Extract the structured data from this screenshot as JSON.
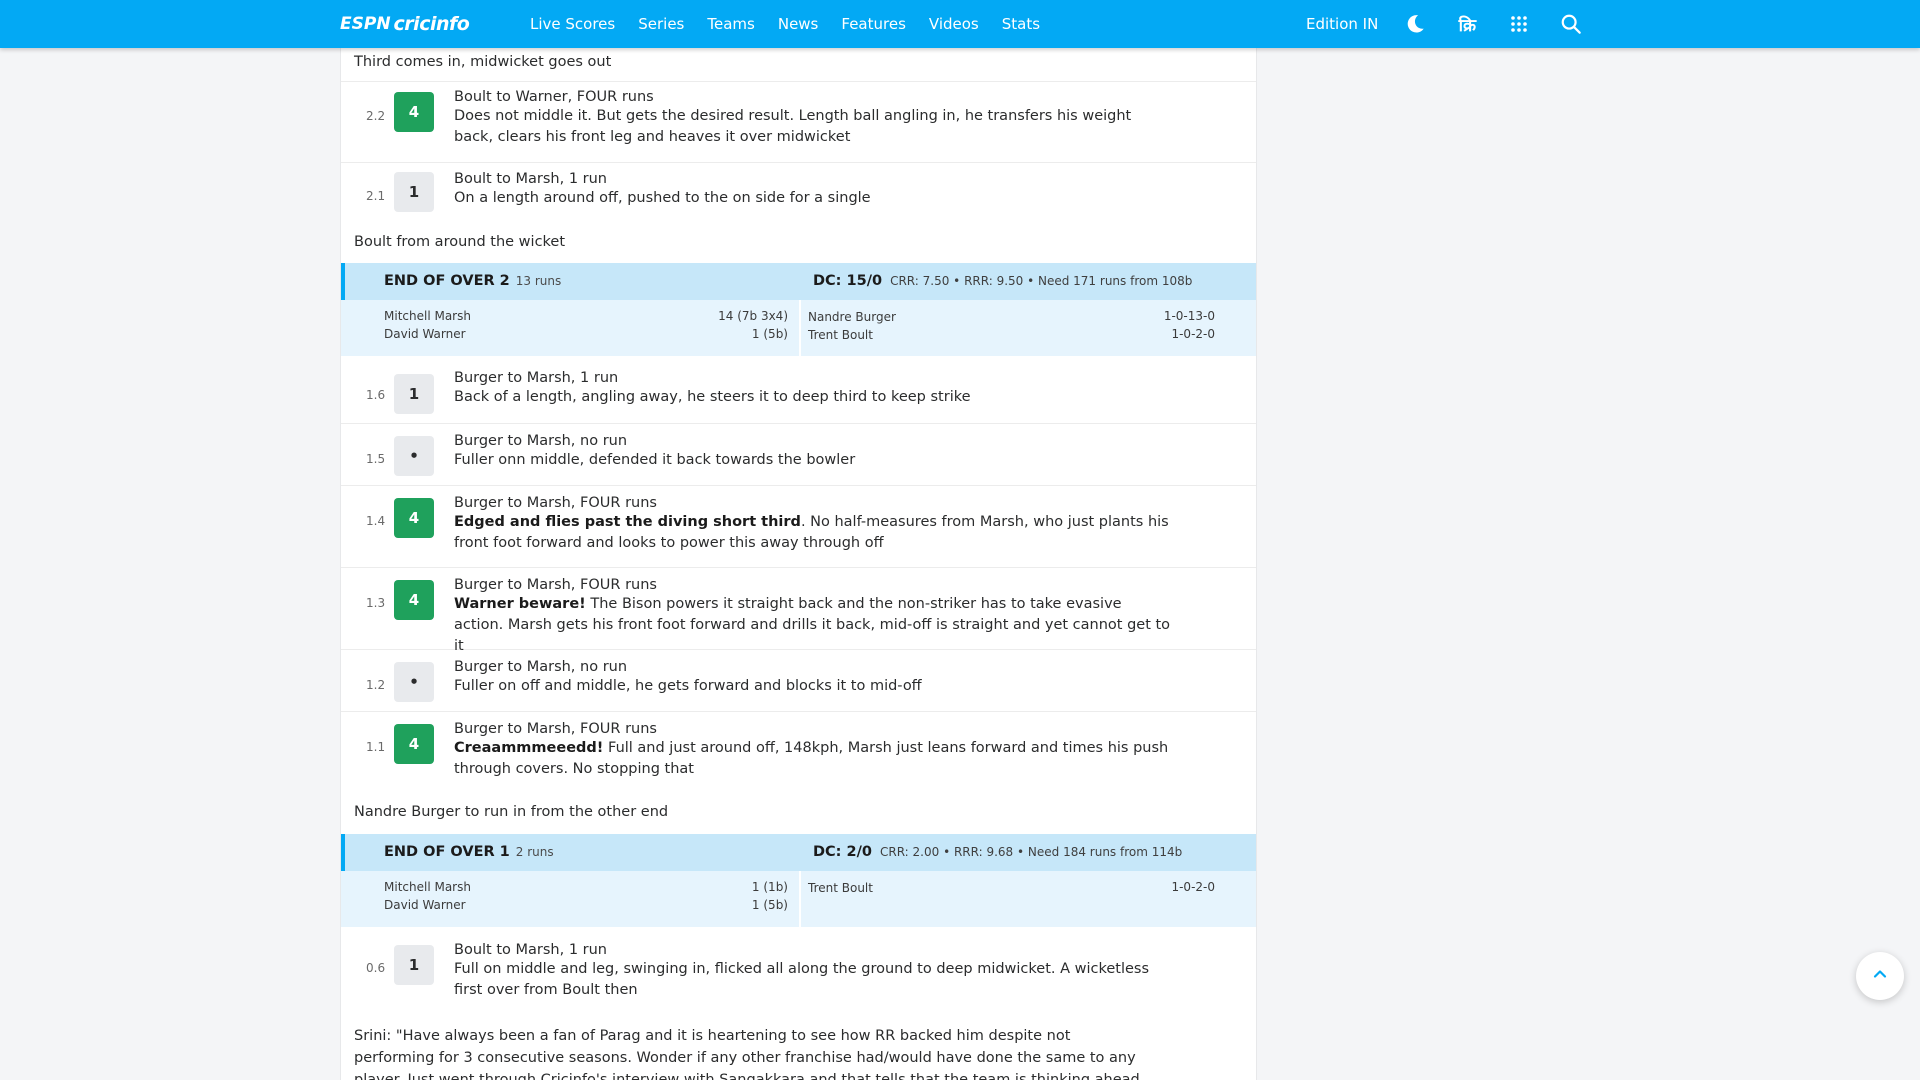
{
  "nav": {
    "logo_espn": "ESPN",
    "logo_cricinfo": "cricinfo",
    "links": [
      "Live Scores",
      "Series",
      "Teams",
      "News",
      "Features",
      "Videos",
      "Stats"
    ],
    "edition": "Edition IN",
    "hindi_label": "क्रि"
  },
  "commentary": {
    "top_note": "Third comes in, midwicket goes out",
    "balls_top": [
      {
        "over": "2.2",
        "runs": "4",
        "title": "Boult to Warner, FOUR runs",
        "text_bold": "",
        "text": "Does not middle it. But gets the desired result. Length ball angling in, he transfers his weight back, clears his front leg and heaves it over midwicket"
      },
      {
        "over": "2.1",
        "runs": "1",
        "title": "Boult to Marsh, 1 run",
        "text_bold": "",
        "text": "On a length around off, pushed to the on side for a single"
      }
    ],
    "note_before_over2": "Boult from around the wicket",
    "end_of_over_2": {
      "label": "END OF OVER 2",
      "runs": "13 runs",
      "team_score": "DC: 15/0",
      "rates": "CRR: 7.50 • RRR: 9.50 • Need 171 runs from 108b",
      "batters": [
        {
          "name": "Mitchell Marsh",
          "score": "14 (7b 3x4)"
        },
        {
          "name": "David Warner",
          "score": "1 (5b)"
        }
      ],
      "bowlers": [
        {
          "name": "Nandre Burger",
          "figures": "1-0-13-0"
        },
        {
          "name": "Trent Boult",
          "figures": "1-0-2-0"
        }
      ]
    },
    "balls_over2": [
      {
        "over": "1.6",
        "runs": "1",
        "title": "Burger to Marsh, 1 run",
        "text_bold": "",
        "text": "Back of a length, angling away, he steers it to deep third to keep strike"
      },
      {
        "over": "1.5",
        "runs": "•",
        "title": "Burger to Marsh, no run",
        "text_bold": "",
        "text": "Fuller onn middle, defended it back towards the bowler"
      },
      {
        "over": "1.4",
        "runs": "4",
        "title": "Burger to Marsh, FOUR runs",
        "text_bold": "Edged and flies past the diving short third",
        "text": ". No half-measures from Marsh, who just plants his front foot forward and looks to power this away through off"
      },
      {
        "over": "1.3",
        "runs": "4",
        "title": "Burger to Marsh, FOUR runs",
        "text_bold": "Warner beware!",
        "text": " The Bison powers it straight back and the non-striker has to take evasive action. Marsh gets his front foot forward and drills it back, mid-off is straight and yet cannot get to it"
      },
      {
        "over": "1.2",
        "runs": "•",
        "title": "Burger to Marsh, no run",
        "text_bold": "",
        "text": "Fuller on off and middle, he gets forward and blocks it to mid-off"
      },
      {
        "over": "1.1",
        "runs": "4",
        "title": "Burger to Marsh, FOUR runs",
        "text_bold": "Creaammmeeedd!",
        "text": " Full and just around off, 148kph, Marsh just leans forward and times his push through covers. No stopping that"
      }
    ],
    "note_before_over1": "Nandre Burger to run in from the other end",
    "end_of_over_1": {
      "label": "END OF OVER 1",
      "runs": "2 runs",
      "team_score": "DC: 2/0",
      "rates": "CRR: 2.00 • RRR: 9.68 • Need 184 runs from 114b",
      "batters": [
        {
          "name": "Mitchell Marsh",
          "score": "1 (1b)"
        },
        {
          "name": "David Warner",
          "score": "1 (5b)"
        }
      ],
      "bowlers": [
        {
          "name": "Trent Boult",
          "figures": "1-0-2-0"
        }
      ]
    },
    "balls_over0": [
      {
        "over": "0.6",
        "runs": "1",
        "title": "Boult to Marsh, 1 run",
        "text_bold": "",
        "text": "Full on middle and leg, swinging in, flicked all along the ground to deep midwicket. A wicketless first over from Boult then"
      }
    ],
    "bottom_note": "Srini: \"Have always been a fan of Parag and it is heartening to see how RR backed him despite not performing for 3 consecutive seasons. Wonder if any other franchise had/would have done the same to any player. Just went through Cricinfo's interview with Sangakkara and that tells that the team is thinking ahead and is keen to get players ready"
  },
  "colors": {
    "nav_bg": "#03a9f4",
    "four_badge": "#1fa15c",
    "dot_badge": "#e8eaed",
    "eoo_head": "#c6e7f9",
    "eoo_body": "#e6f4fd"
  },
  "icons": [
    "moon-icon",
    "hindi-icon",
    "apps-grid-icon",
    "search-icon",
    "chevron-up-icon"
  ]
}
